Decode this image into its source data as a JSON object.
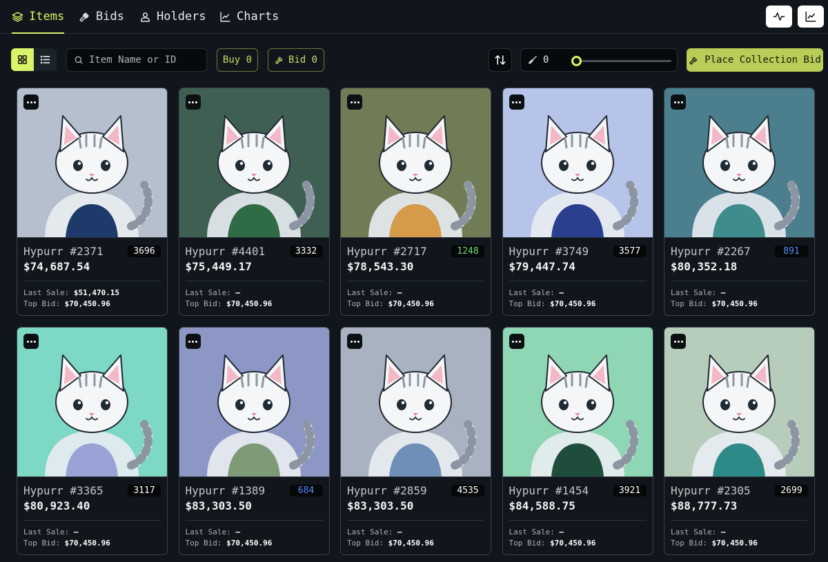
{
  "nav": {
    "tabs": [
      {
        "label": "Items",
        "icon": "layers-icon",
        "active": true
      },
      {
        "label": "Bids",
        "icon": "gavel-icon",
        "active": false
      },
      {
        "label": "Holders",
        "icon": "users-icon",
        "active": false
      },
      {
        "label": "Charts",
        "icon": "line-chart-icon",
        "active": false
      }
    ],
    "right_icons": [
      "activity-icon",
      "chart-icon"
    ]
  },
  "toolbar": {
    "search_placeholder": "Item Name or ID",
    "buy_label": "Buy 0",
    "bid_label": "Bid 0",
    "sweep_value": "0",
    "sweep_fraction": 0,
    "collection_bid_label": "Place Collection Bid"
  },
  "colors": {
    "accent": "#d9f36a",
    "rank_green": "#6ee06e",
    "rank_blue": "#5b8cff",
    "rank_white": "#ffffff"
  },
  "labels": {
    "last_sale": "Last Sale:",
    "top_bid": "Top Bid:"
  },
  "items": [
    {
      "name": "Hypurr #2371",
      "rank": "3696",
      "rank_color": "#ffffff",
      "price": "$74,687.54",
      "last_sale": "$51,470.15",
      "top_bid": "$70,450.96",
      "bg": "#b6bfcd"
    },
    {
      "name": "Hypurr #4401",
      "rank": "3332",
      "rank_color": "#ffffff",
      "price": "$75,449.17",
      "last_sale": "–",
      "top_bid": "$70,450.96",
      "bg": "#3f5f52"
    },
    {
      "name": "Hypurr #2717",
      "rank": "1248",
      "rank_color": "#6ee06e",
      "price": "$78,543.30",
      "last_sale": "–",
      "top_bid": "$70,450.96",
      "bg": "#6f7c55"
    },
    {
      "name": "Hypurr #3749",
      "rank": "3577",
      "rank_color": "#ffffff",
      "price": "$79,447.74",
      "last_sale": "–",
      "top_bid": "$70,450.96",
      "bg": "#b7c4ea"
    },
    {
      "name": "Hypurr #2267",
      "rank": "891",
      "rank_color": "#5b8cff",
      "price": "$80,352.18",
      "last_sale": "–",
      "top_bid": "$70,450.96",
      "bg": "#4b7f8e"
    },
    {
      "name": "Hypurr #3365",
      "rank": "3117",
      "rank_color": "#ffffff",
      "price": "$80,923.40",
      "last_sale": "–",
      "top_bid": "$70,450.96",
      "bg": "#7ed8c6"
    },
    {
      "name": "Hypurr #1389",
      "rank": "684",
      "rank_color": "#5b8cff",
      "price": "$83,303.50",
      "last_sale": "–",
      "top_bid": "$70,450.96",
      "bg": "#8d97c6"
    },
    {
      "name": "Hypurr #2859",
      "rank": "4535",
      "rank_color": "#ffffff",
      "price": "$83,303.50",
      "last_sale": "–",
      "top_bid": "$70,450.96",
      "bg": "#a9b2c0"
    },
    {
      "name": "Hypurr #1454",
      "rank": "3921",
      "rank_color": "#ffffff",
      "price": "$84,588.75",
      "last_sale": "–",
      "top_bid": "$70,450.96",
      "bg": "#8fd6b4"
    },
    {
      "name": "Hypurr #2305",
      "rank": "2699",
      "rank_color": "#ffffff",
      "price": "$88,777.73",
      "last_sale": "–",
      "top_bid": "$70,450.96",
      "bg": "#b7cdbc"
    }
  ]
}
